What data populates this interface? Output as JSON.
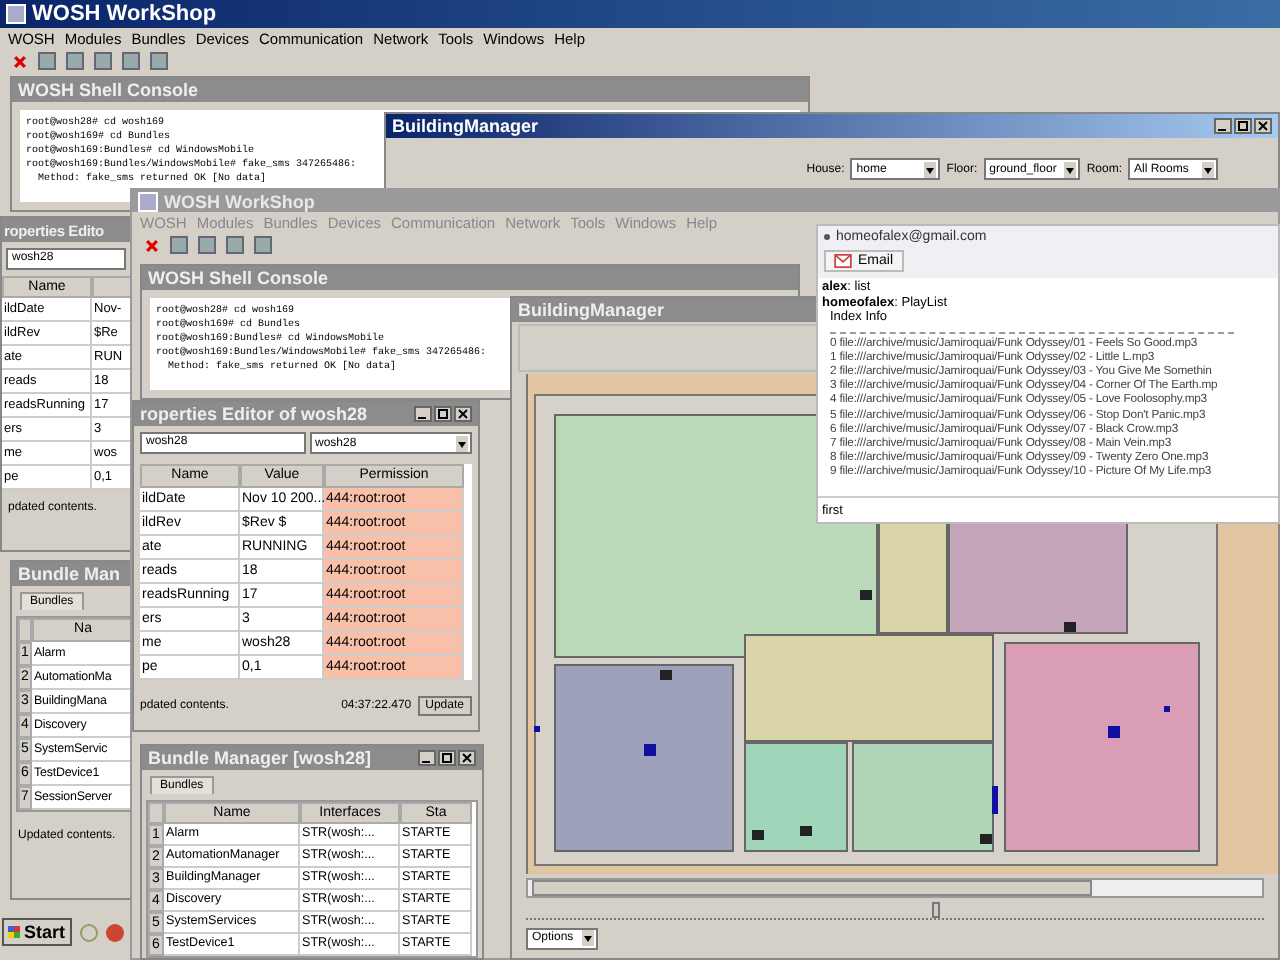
{
  "back_app": {
    "title": "WOSH WorkShop",
    "menu": [
      "WOSH",
      "Modules",
      "Bundles",
      "Devices",
      "Communication",
      "Network",
      "Tools",
      "Windows",
      "Help"
    ]
  },
  "back_shell": {
    "title": "WOSH Shell Console",
    "lines": [
      "root@wosh28# cd wosh169",
      "root@wosh169# cd Bundles",
      "root@wosh169:Bundles# cd WindowsMobile",
      "root@wosh169:Bundles/WindowsMobile# fake_sms 347265486:",
      "  Method: fake_sms returned OK [No data]"
    ]
  },
  "back_building": {
    "title": "BuildingManager",
    "selectors": [
      {
        "label": "House:",
        "value": "home"
      },
      {
        "label": "Floor:",
        "value": "ground_floor"
      },
      {
        "label": "Room:",
        "value": "All Rooms"
      }
    ]
  },
  "back_properties": {
    "title": "roperties Edito",
    "field": "wosh28",
    "column": "Name",
    "rows": [
      {
        "name": "ildDate",
        "value": "Nov-"
      },
      {
        "name": "ildRev",
        "value": "$Re"
      },
      {
        "name": "ate",
        "value": "RUN"
      },
      {
        "name": "reads",
        "value": "18"
      },
      {
        "name": "readsRunning",
        "value": "17"
      },
      {
        "name": "ers",
        "value": "3"
      },
      {
        "name": "me",
        "value": "wos"
      },
      {
        "name": "pe",
        "value": "0,1"
      }
    ],
    "status": "pdated contents."
  },
  "back_bundles": {
    "title": "Bundle Man",
    "tab": "Bundles",
    "column": "Na",
    "rows": [
      {
        "index": "1",
        "name": "Alarm"
      },
      {
        "index": "2",
        "name": "AutomationMa"
      },
      {
        "index": "3",
        "name": "BuildingMana"
      },
      {
        "index": "4",
        "name": "Discovery"
      },
      {
        "index": "5",
        "name": "SystemServic"
      },
      {
        "index": "6",
        "name": "TestDevice1"
      },
      {
        "index": "7",
        "name": "SessionServer"
      }
    ],
    "status": "Updated contents."
  },
  "taskbar": {
    "start": "Start"
  },
  "front_app": {
    "title": "WOSH WorkShop",
    "menu": [
      "WOSH",
      "Modules",
      "Bundles",
      "Devices",
      "Communication",
      "Network",
      "Tools",
      "Windows",
      "Help"
    ]
  },
  "front_shell": {
    "title": "WOSH Shell Console",
    "lines": [
      "root@wosh28# cd wosh169",
      "root@wosh169# cd Bundles",
      "root@wosh169:Bundles# cd WindowsMobile",
      "root@wosh169:Bundles/WindowsMobile# fake_sms 347265486:",
      "  Method: fake_sms returned OK [No data]"
    ]
  },
  "front_building": {
    "title": "BuildingManager",
    "rooms": [
      {
        "color": "#b9d9b9"
      },
      {
        "color": "#d9d5a9"
      },
      {
        "color": "#c5a5b9"
      },
      {
        "color": "#d9d5a9"
      },
      {
        "color": "#9da1b9"
      },
      {
        "color": "#a1d5b9"
      },
      {
        "color": "#b1d5b9"
      },
      {
        "color": "#d99db5"
      }
    ],
    "slider": {
      "level": 0.55
    },
    "options": "Options"
  },
  "front_properties": {
    "title": "roperties Editor of wosh28",
    "field": "wosh28",
    "dropdown": "wosh28",
    "columns": [
      "Name",
      "Value",
      "Permission"
    ],
    "rows": [
      {
        "name": "ildDate",
        "value": "Nov 10 200...",
        "permission": "444:root:root"
      },
      {
        "name": "ildRev",
        "value": "$Rev $",
        "permission": "444:root:root"
      },
      {
        "name": "ate",
        "value": "RUNNING",
        "permission": "444:root:root"
      },
      {
        "name": "reads",
        "value": "18",
        "permission": "444:root:root"
      },
      {
        "name": "readsRunning",
        "value": "17",
        "permission": "444:root:root"
      },
      {
        "name": "ers",
        "value": "3",
        "permission": "444:root:root"
      },
      {
        "name": "me",
        "value": "wosh28",
        "permission": "444:root:root"
      },
      {
        "name": "pe",
        "value": "0,1",
        "permission": "444:root:root"
      }
    ],
    "status": "pdated contents.",
    "time": "04:37:22.470",
    "button": "Update"
  },
  "front_bundles": {
    "title": "Bundle Manager [wosh28]",
    "tab": "Bundles",
    "columns": [
      "Name",
      "Interfaces",
      "Sta"
    ],
    "rows": [
      {
        "index": "1",
        "name": "Alarm",
        "interfaces": "STR(wosh:...",
        "state": "STARTE"
      },
      {
        "index": "2",
        "name": "AutomationManager",
        "interfaces": "STR(wosh:...",
        "state": "STARTE"
      },
      {
        "index": "3",
        "name": "BuildingManager",
        "interfaces": "STR(wosh:...",
        "state": "STARTE"
      },
      {
        "index": "4",
        "name": "Discovery",
        "interfaces": "STR(wosh:...",
        "state": "STARTE"
      },
      {
        "index": "5",
        "name": "SystemServices",
        "interfaces": "STR(wosh:...",
        "state": "STARTE"
      },
      {
        "index": "6",
        "name": "TestDevice1",
        "interfaces": "STR(wosh:...",
        "state": "STARTE"
      }
    ]
  },
  "chat": {
    "account": "homeofalex@gmail.com",
    "button": "Email",
    "messages": [
      {
        "sender": "alex",
        "text": ": list"
      },
      {
        "sender": "homeofalex",
        "text": ": PlayList"
      }
    ],
    "heading": "Index Info",
    "lines": [
      "0 file:///archive/music/Jamiroquai/Funk Odyssey/01 - Feels So Good.mp3",
      "1 file:///archive/music/Jamiroquai/Funk Odyssey/02 - Little L.mp3",
      "2 file:///archive/music/Jamiroquai/Funk Odyssey/03 - You Give Me Somethin",
      "3 file:///archive/music/Jamiroquai/Funk Odyssey/04 - Corner Of The Earth.mp",
      "4 file:///archive/music/Jamiroquai/Funk Odyssey/05 - Love Foolosophy.mp3",
      "5 file:///archive/music/Jamiroquai/Funk Odyssey/06 - Stop Don't Panic.mp3",
      "6 file:///archive/music/Jamiroquai/Funk Odyssey/07 - Black Crow.mp3",
      "7 file:///archive/music/Jamiroquai/Funk Odyssey/08 - Main Vein.mp3",
      "8 file:///archive/music/Jamiroquai/Funk Odyssey/09 - Twenty Zero One.mp3",
      "9 file:///archive/music/Jamiroquai/Funk Odyssey/10 - Picture Of My Life.mp3"
    ],
    "input": "first"
  }
}
